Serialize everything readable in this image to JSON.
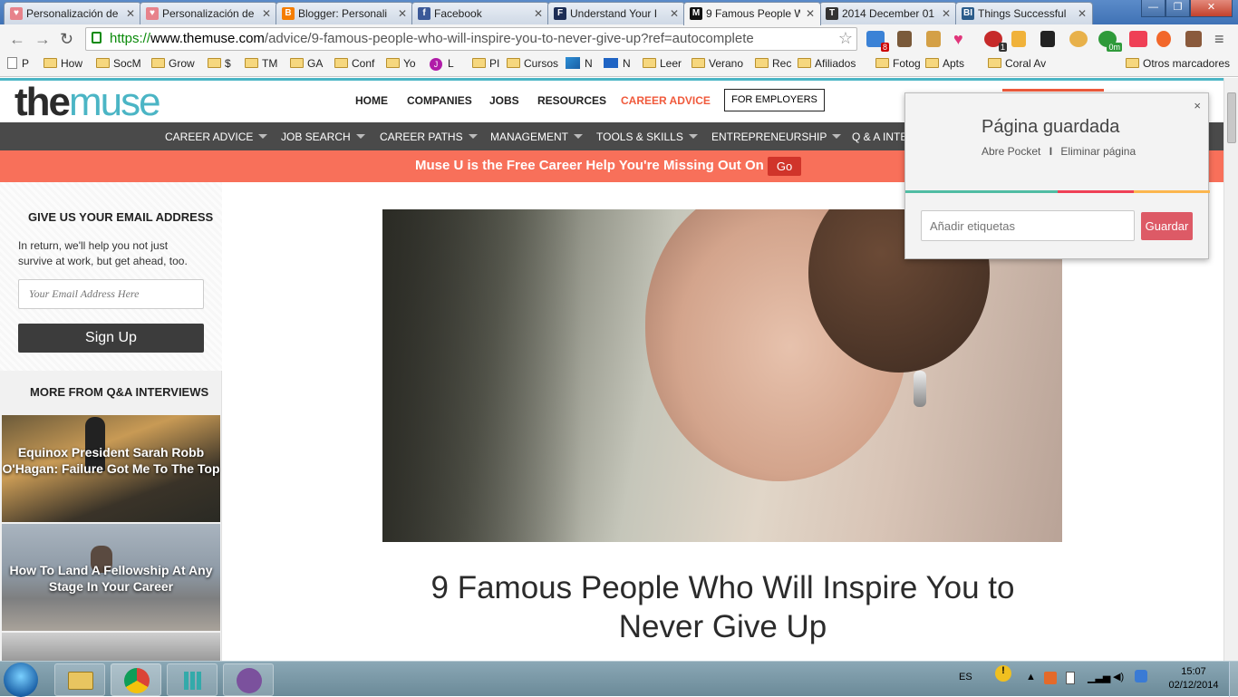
{
  "tabs": [
    {
      "label": "Personalización de",
      "icon": "heart-icon",
      "color": "#e7828b"
    },
    {
      "label": "Personalización de",
      "icon": "heart-icon",
      "color": "#e7828b"
    },
    {
      "label": "Blogger: Personali",
      "icon": "blogger-icon",
      "color": "#f57d00"
    },
    {
      "label": "Facebook",
      "icon": "facebook-icon",
      "color": "#3b5998"
    },
    {
      "label": "Understand Your I",
      "icon": "forbes-icon",
      "color": "#1c2d55"
    },
    {
      "label": "9 Famous People W",
      "icon": "muse-icon",
      "color": "#111111",
      "active": true
    },
    {
      "label": "2014 December 01",
      "icon": "nyt-icon",
      "color": "#333333"
    },
    {
      "label": "Things Successful",
      "icon": "bi-icon",
      "color": "#2b5c8a"
    }
  ],
  "window_controls": {
    "minimize": "—",
    "maximize": "❐",
    "close": "✕"
  },
  "toolbar": {
    "url_scheme": "https://",
    "url_host": "www.themuse.com",
    "url_path": "/advice/9-famous-people-who-will-inspire-you-to-never-give-up?ref=autocomplete",
    "extension_badges": {
      "plus": "8",
      "adblock": "1",
      "timer": "0m"
    }
  },
  "bookmarks": [
    {
      "label": "P",
      "type": "page"
    },
    {
      "label": "How",
      "type": "folder"
    },
    {
      "label": "SocM",
      "type": "folder"
    },
    {
      "label": "Grow",
      "type": "folder"
    },
    {
      "label": "$",
      "type": "folder"
    },
    {
      "label": "TM",
      "type": "folder"
    },
    {
      "label": "GA",
      "type": "folder"
    },
    {
      "label": "Conf",
      "type": "folder"
    },
    {
      "label": "Yo",
      "type": "folder"
    },
    {
      "label": "L",
      "type": "j-icon"
    },
    {
      "label": "PI",
      "type": "folder"
    },
    {
      "label": "Cursos",
      "type": "folder"
    },
    {
      "label": "N",
      "type": "blue-icon"
    },
    {
      "label": "N",
      "type": "mail-icon"
    },
    {
      "label": "Leer",
      "type": "folder"
    },
    {
      "label": "Verano",
      "type": "folder"
    },
    {
      "label": "Rec",
      "type": "folder"
    },
    {
      "label": "Afiliados",
      "type": "folder"
    },
    {
      "label": "Fotog",
      "type": "folder"
    },
    {
      "label": "Apts",
      "type": "folder"
    },
    {
      "label": "Coral Av",
      "type": "folder"
    }
  ],
  "other_bookmarks": "Otros marcadores",
  "site": {
    "logo_the": "the",
    "logo_muse": "muse",
    "nav": [
      "HOME",
      "COMPANIES",
      "JOBS",
      "RESOURCES",
      "CAREER ADVICE"
    ],
    "nav_active": "CAREER ADVICE",
    "for_employers": "FOR EMPLOYERS",
    "secondary_nav": [
      "CAREER ADVICE",
      "JOB SEARCH",
      "CAREER PATHS",
      "MANAGEMENT",
      "TOOLS & SKILLS",
      "ENTREPRENEURSHIP",
      "Q & A INTE"
    ],
    "banner_text": "Muse U is the Free Career Help You're Missing Out On",
    "banner_button": "Go"
  },
  "sidebar": {
    "signup_title": "GIVE US YOUR EMAIL ADDRESS",
    "signup_desc": "In return, we'll help you not just survive at work, but get ahead, too.",
    "email_placeholder": "Your Email Address Here",
    "signup_button": "Sign Up",
    "more_title": "MORE FROM Q&A INTERVIEWS",
    "articles": [
      {
        "title": "Equinox President Sarah Robb O'Hagan: Failure Got Me To The Top"
      },
      {
        "title": "How To Land A Fellowship At Any Stage In Your Career"
      }
    ]
  },
  "article": {
    "title": "9 Famous People Who Will Inspire You to Never Give Up"
  },
  "pocket": {
    "title": "Página guardada",
    "open_link": "Abre Pocket",
    "separator": "I",
    "remove_link": "Eliminar página",
    "tags_placeholder": "Añadir etiquetas",
    "save_button": "Guardar",
    "close": "×",
    "colors": [
      "#50bca3",
      "#ef4056",
      "#fcb64e"
    ]
  },
  "taskbar": {
    "language": "ES",
    "time": "15:07",
    "date": "02/12/2014"
  }
}
